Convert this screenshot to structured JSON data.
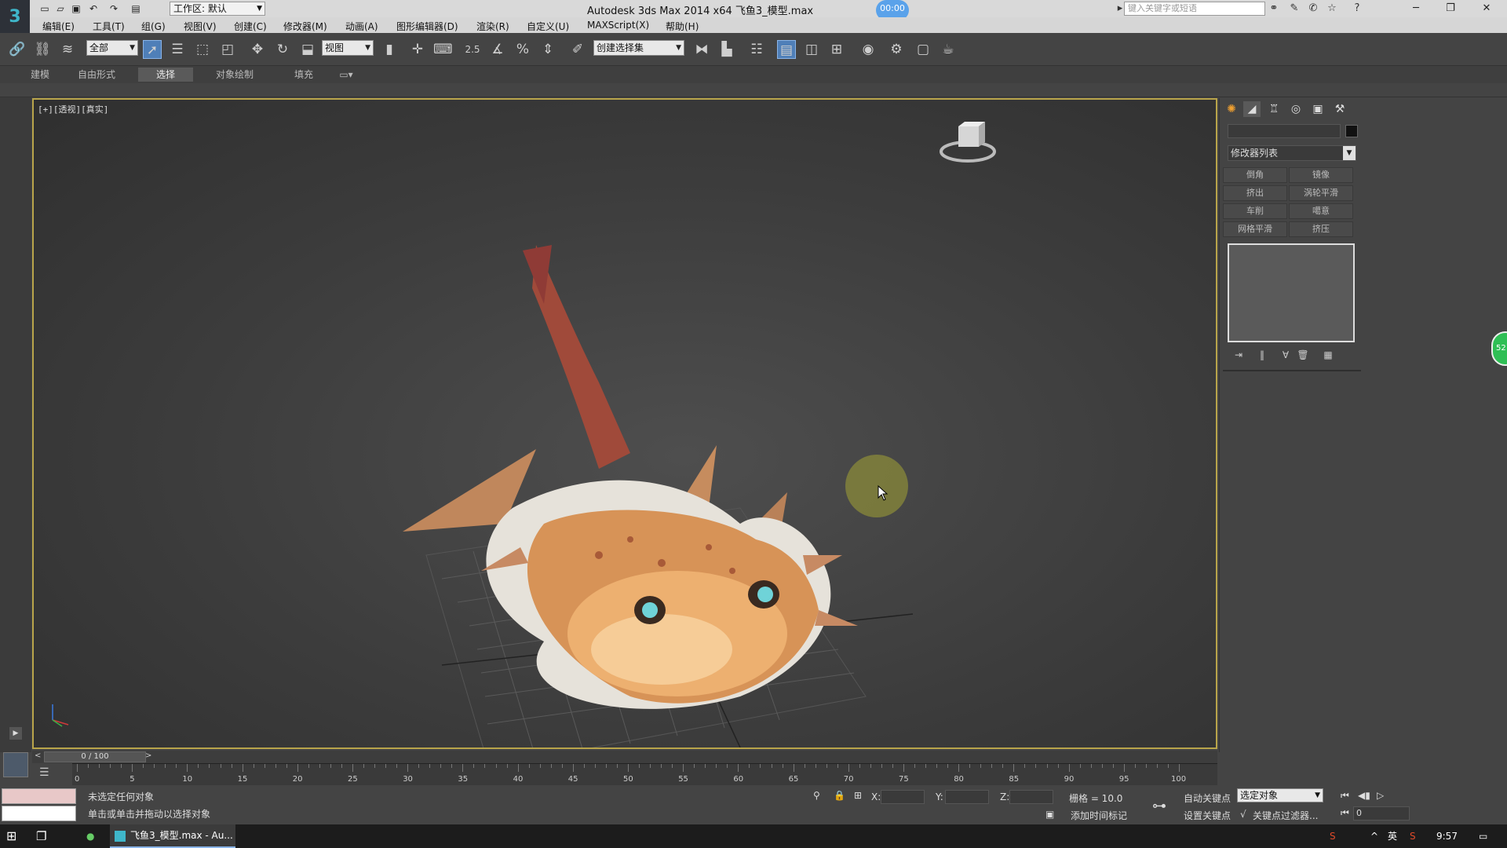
{
  "titlebar": {
    "workspace": "工作区: 默认",
    "title": "Autodesk 3ds Max  2014 x64      飞鱼3_模型.max",
    "search_placeholder": "键入关键字或短语",
    "timer": "00:00"
  },
  "menu": [
    "编辑(E)",
    "工具(T)",
    "组(G)",
    "视图(V)",
    "创建(C)",
    "修改器(M)",
    "动画(A)",
    "图形编辑器(D)",
    "渲染(R)",
    "自定义(U)",
    "MAXScript(X)",
    "帮助(H)"
  ],
  "toolbar": {
    "selection_filter": "全部",
    "ref_coord": "视图",
    "snap_value": "2.5",
    "named_selection": "创建选择集"
  },
  "ribbon_tabs": [
    "建模",
    "自由形式",
    "选择",
    "对象绘制",
    "填充"
  ],
  "ribbon_active": "选择",
  "viewport": {
    "label": "[+][透视][真实]"
  },
  "command_panel": {
    "modifier_list": "修改器列表",
    "buttons": [
      "倒角",
      "镜像",
      "挤出",
      "涡轮平滑",
      "车削",
      "噶意",
      "网格平滑",
      "挤压"
    ]
  },
  "timeline": {
    "frame_display": "0 / 100",
    "prev": "<",
    "next": ">",
    "ticks": [
      0,
      5,
      10,
      15,
      20,
      25,
      30,
      35,
      40,
      45,
      50,
      55,
      60,
      65,
      70,
      75,
      80,
      85,
      90,
      95,
      100
    ]
  },
  "status": {
    "line1": "未选定任何对象",
    "line2": "单击或单击并拖动以选择对象",
    "x_label": "X:",
    "y_label": "Y:",
    "z_label": "Z:",
    "grid": "栅格 = 10.0",
    "add_time_tag": "添加时间标记",
    "auto_key": "自动关键点",
    "set_key": "设置关键点",
    "selected_object": "选定对象",
    "key_filters": "关键点过滤器...",
    "frame": "0"
  },
  "taskbar": {
    "app": "飞鱼3_模型.max - Au...",
    "lang": "英",
    "time": "9:57"
  },
  "badge": "52",
  "colors": {
    "viewport_border": "#b8a44a",
    "active_blue": "#4f7fb8",
    "timer_blue": "#5aa2ea",
    "badge_green": "#2fbf55"
  }
}
